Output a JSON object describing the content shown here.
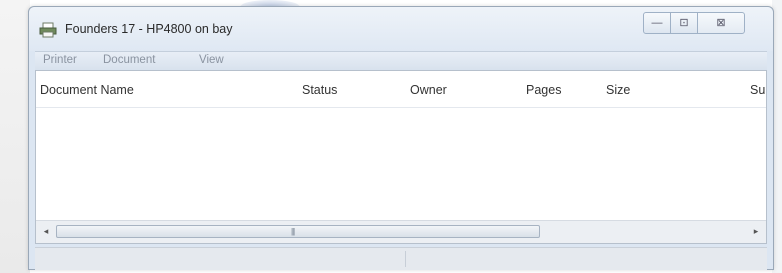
{
  "window": {
    "title": "Founders 17 - HP4800 on bay",
    "controls": {
      "minimize": "—",
      "maximize": "⊡",
      "close": "⊠"
    }
  },
  "menu": [
    "Printer",
    "Document",
    "View"
  ],
  "columns": [
    "Document Name",
    "Status",
    "Owner",
    "Pages",
    "Size",
    "Sul"
  ],
  "scrollbar": {
    "left_arrow": "◂",
    "right_arrow": "▸",
    "grip": "|||"
  },
  "colors": {
    "title_bg": "#dfe8f3",
    "menu_text": "#8a93a0",
    "border": "#9aa8b8"
  },
  "icons": [
    "printer-icon"
  ]
}
